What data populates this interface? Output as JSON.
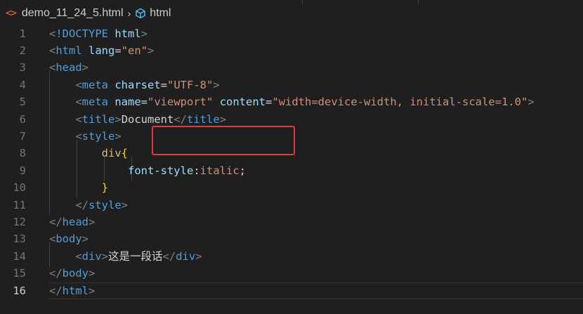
{
  "breadcrumb": {
    "file_icon": "html-file-icon",
    "file_name": "demo_11_24_5.html",
    "separator": "›",
    "element_icon": "element-cube-icon",
    "element_name": "html"
  },
  "colors": {
    "background": "#1f1f1f",
    "tag": "#569cd6",
    "attribute": "#9cdcfe",
    "string": "#ce9178",
    "selector": "#d7ba7d",
    "brace": "#ffd700",
    "line_number": "#6e7681",
    "annotation_box": "#e0393e"
  },
  "editor": {
    "active_line": "16",
    "lines": [
      {
        "num": "1",
        "p": [
          "",
          "<",
          "!DOCTYPE",
          " ",
          "html",
          ">"
        ]
      },
      {
        "num": "2",
        "p": [
          "",
          "<",
          "html",
          " ",
          "lang",
          "=",
          "\"en\"",
          ">"
        ]
      },
      {
        "num": "3",
        "p": [
          "",
          "<",
          "head",
          ">"
        ]
      },
      {
        "num": "4",
        "p": [
          "    ",
          "<",
          "meta",
          " ",
          "charset",
          "=",
          "\"UTF-8\"",
          ">"
        ]
      },
      {
        "num": "5",
        "p": [
          "    ",
          "<",
          "meta",
          " ",
          "name",
          "=",
          "\"viewport\"",
          " ",
          "content",
          "=",
          "\"width=device-width, initial-scale=1.0\"",
          ">"
        ]
      },
      {
        "num": "6",
        "p": [
          "    ",
          "<",
          "title",
          ">",
          "Document",
          "</",
          "title",
          ">"
        ]
      },
      {
        "num": "7",
        "p": [
          "    ",
          "<",
          "style",
          ">"
        ]
      },
      {
        "num": "8",
        "p": [
          "        ",
          "div",
          "{"
        ]
      },
      {
        "num": "9",
        "p": [
          "        ",
          "    ",
          "font-style",
          ":",
          "italic",
          ";"
        ]
      },
      {
        "num": "10",
        "p": [
          "        ",
          "}"
        ]
      },
      {
        "num": "11",
        "p": [
          "    ",
          "</",
          "style",
          ">"
        ]
      },
      {
        "num": "12",
        "p": [
          "",
          "</",
          "head",
          ">"
        ]
      },
      {
        "num": "13",
        "p": [
          "",
          "<",
          "body",
          ">"
        ]
      },
      {
        "num": "14",
        "p": [
          "    ",
          "<",
          "div",
          ">",
          "这是一段话",
          "</",
          "div",
          ">"
        ]
      },
      {
        "num": "15",
        "p": [
          "",
          "</",
          "body",
          ">"
        ]
      },
      {
        "num": "16",
        "p": [
          "",
          "</",
          "html",
          ">"
        ]
      }
    ]
  }
}
